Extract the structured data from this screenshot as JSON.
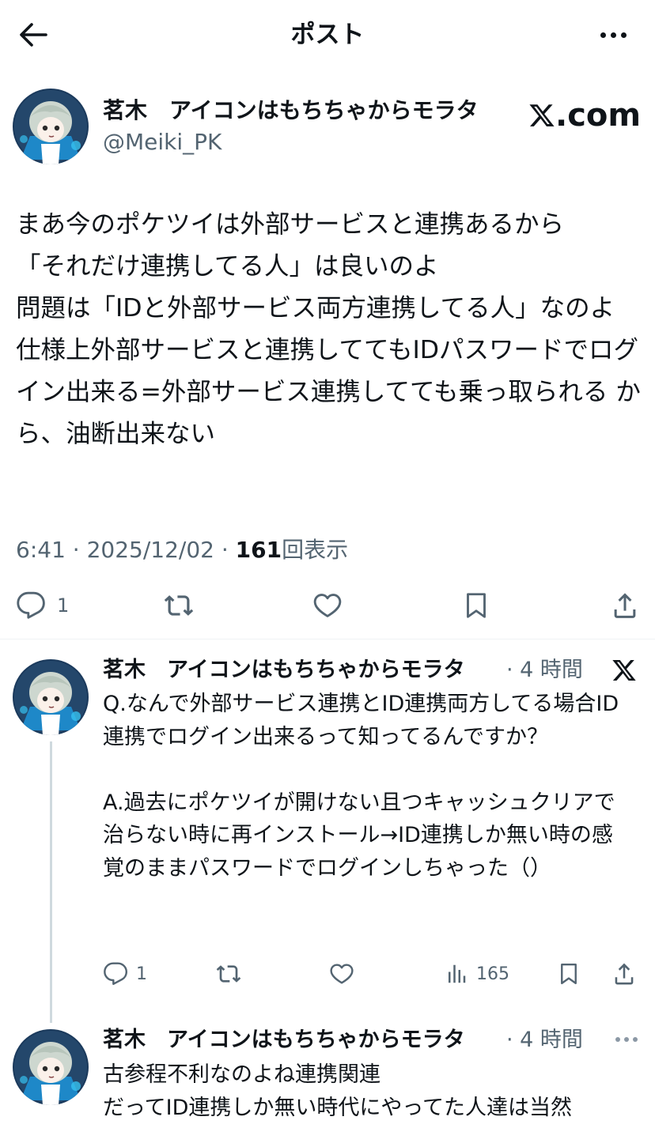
{
  "header": {
    "title": "ポスト"
  },
  "main_post": {
    "author_name": "茗木　アイコンはもちちゃからモラタ",
    "handle": "@Meiki_PK",
    "source_logo": ".com",
    "text": "まあ今のポケツイは外部サービスと連携あるから\n「それだけ連携してる人」は良いのよ\n問題は「IDと外部サービス両方連携してる人」なのよ\n仕様上外部サービスと連携しててもIDパスワードでログイン出来る=外部サービス連携してても乗っ取られる から、油断出来ない",
    "time": "6:41 · 2025/12/02 · ",
    "views_count": "161",
    "views_label": "回表示",
    "reply_count": "1"
  },
  "replies": [
    {
      "author_name": "茗木　アイコンはもちちゃからモラタ",
      "time": "· 4 時間",
      "text": "Q.なんで外部サービス連携とID連携両方してる場合ID連携でログイン出来るって知ってるんですか？\n\nA.過去にポケツイが開けない且つキャッシュクリアで治らない時に再インストール→ID連携しか無い時の感覚のままパスワードでログインしちゃった（）",
      "reply_count": "1",
      "view_count": "165"
    },
    {
      "author_name": "茗木　アイコンはもちちゃからモラタ",
      "time": "· 4 時間",
      "text": "古参程不利なのよね連携関連\nだってID連携しか無い時代にやってた人達は当然"
    }
  ],
  "colors": {
    "text": "#0f1419",
    "muted": "#536471",
    "divider": "#eff3f4",
    "thread_line": "#cfd9de"
  }
}
